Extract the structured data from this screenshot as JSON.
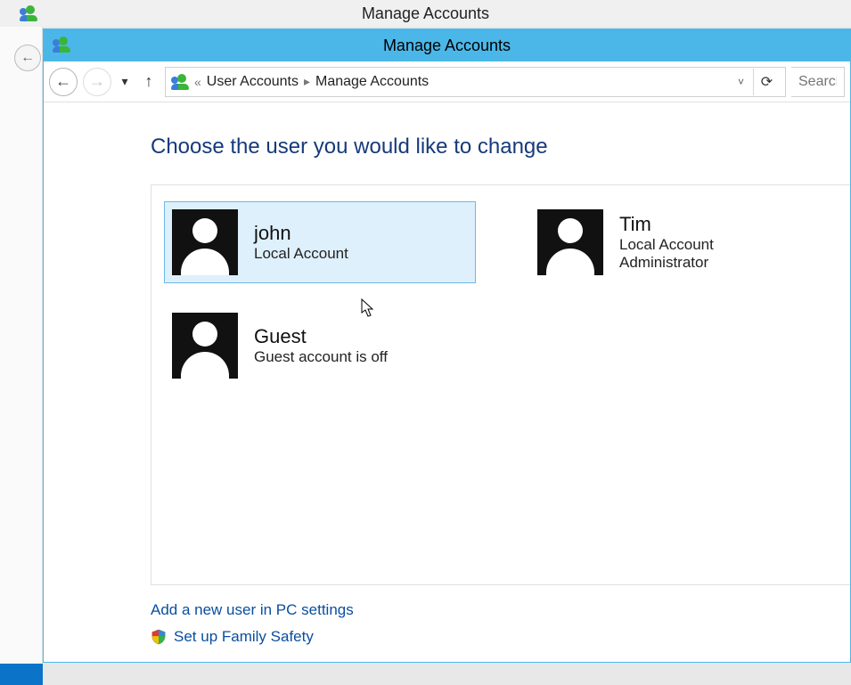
{
  "background_window": {
    "title": "Manage Accounts"
  },
  "window": {
    "title": "Manage Accounts"
  },
  "breadcrumb": {
    "overflow_label": "«",
    "part1": "User Accounts",
    "part2": "Manage Accounts"
  },
  "search": {
    "placeholder": "Search"
  },
  "heading": "Choose the user you would like to change",
  "accounts": [
    {
      "name": "john",
      "line1": "Local Account",
      "line2": "",
      "selected": true
    },
    {
      "name": "Tim",
      "line1": "Local Account",
      "line2": "Administrator",
      "selected": false
    },
    {
      "name": "Guest",
      "line1": "Guest account is off",
      "line2": "",
      "selected": false
    }
  ],
  "links": {
    "add_user": "Add a new user in PC settings",
    "family": "Set up Family Safety"
  }
}
